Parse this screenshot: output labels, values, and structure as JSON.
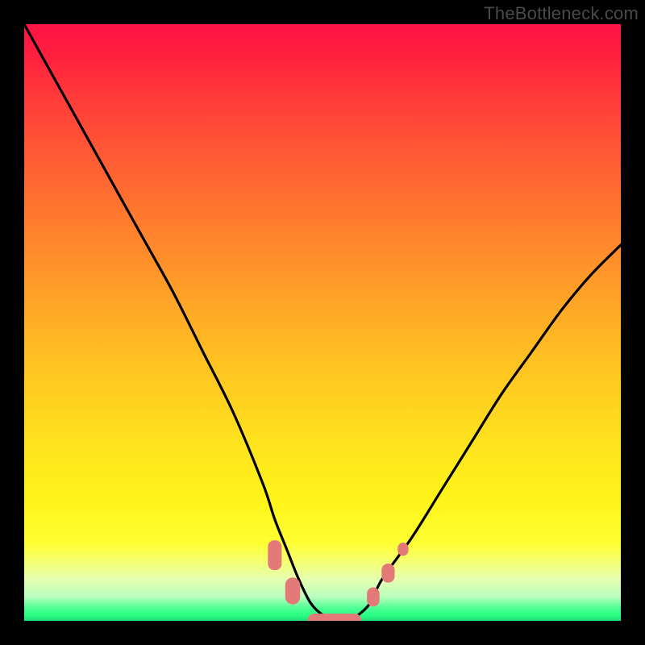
{
  "watermark": "TheBottleneck.com",
  "chart_data": {
    "type": "line",
    "title": "",
    "xlabel": "",
    "ylabel": "",
    "xlim": [
      0,
      100
    ],
    "ylim": [
      0,
      100
    ],
    "grid": false,
    "legend": false,
    "series": [
      {
        "name": "bottleneck-curve",
        "color": "#000000",
        "x": [
          0,
          5,
          10,
          15,
          20,
          25,
          30,
          35,
          40,
          42,
          44,
          46,
          48,
          50,
          52,
          54,
          56,
          58,
          60,
          65,
          70,
          75,
          80,
          85,
          90,
          95,
          100
        ],
        "y": [
          100,
          91,
          82,
          73,
          64,
          55,
          45,
          35,
          23,
          17,
          12,
          7,
          3,
          1,
          0,
          0,
          1,
          3,
          7,
          14,
          22,
          30,
          38,
          45,
          52,
          58,
          63
        ]
      }
    ],
    "markers": [
      {
        "name": "bottom-point",
        "shape": "rounded",
        "color": "#e47a78",
        "x": 52,
        "y": 0,
        "width_x": 9,
        "height_y": 2.4
      },
      {
        "name": "left-lower-marker",
        "shape": "oval",
        "color": "#e47a78",
        "x": 45,
        "y": 5,
        "width_x": 2.5,
        "height_y": 4.5
      },
      {
        "name": "left-upper-marker",
        "shape": "rounded",
        "color": "#e47a78",
        "x": 42,
        "y": 11,
        "width_x": 2.3,
        "height_y": 5
      },
      {
        "name": "right-lower-marker",
        "shape": "oval",
        "color": "#e47a78",
        "x": 58.5,
        "y": 4,
        "width_x": 2.1,
        "height_y": 3.2
      },
      {
        "name": "right-mid-marker",
        "shape": "oval",
        "color": "#e47a78",
        "x": 61,
        "y": 8,
        "width_x": 2.2,
        "height_y": 3.2
      },
      {
        "name": "right-upper-marker",
        "shape": "oval",
        "color": "#e47a78",
        "x": 63.5,
        "y": 12,
        "width_x": 1.8,
        "height_y": 2.2
      }
    ]
  }
}
